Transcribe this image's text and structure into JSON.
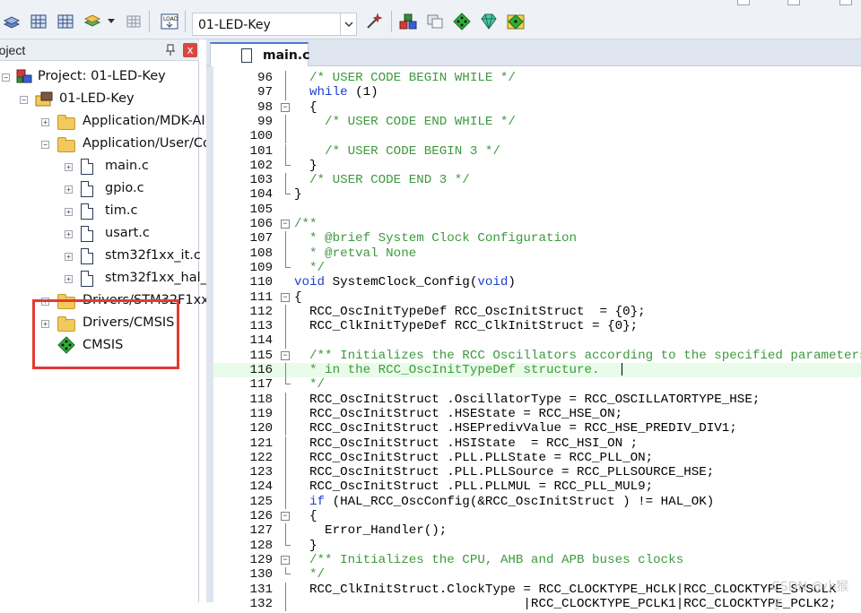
{
  "toolbar": {
    "target_name": "01-LED-Key",
    "colors": {
      "accent": "#4a7bd0",
      "highlight_box": "#e23b33"
    },
    "icons": [
      "stack-icon",
      "grid-icon",
      "grid-icon-2",
      "layers-icon",
      "settings-grid-icon",
      "load-icon",
      "magic-wand-icon",
      "manage-components-icon",
      "copy-icon",
      "debug-diamond-icon",
      "gem-icon",
      "pack-installer-icon"
    ]
  },
  "project_panel": {
    "title": "roject",
    "pin_glyph": "ᵖ",
    "close_glyph": "x",
    "tree": [
      {
        "label": "Project: 01-LED-Key",
        "level": 0,
        "type": "project",
        "expander": "−"
      },
      {
        "label": "01-LED-Key",
        "level": 1,
        "type": "target",
        "expander": "−"
      },
      {
        "label": "Application/MDK-AI",
        "level": 2,
        "type": "folder",
        "expander": "+"
      },
      {
        "label": "Application/User/Co",
        "level": 2,
        "type": "folder",
        "expander": "−"
      },
      {
        "label": "main.c",
        "level": 3,
        "type": "file",
        "expander": "+"
      },
      {
        "label": "gpio.c",
        "level": 3,
        "type": "file",
        "expander": "+"
      },
      {
        "label": "tim.c",
        "level": 3,
        "type": "file",
        "expander": "+"
      },
      {
        "label": "usart.c",
        "level": 3,
        "type": "file",
        "expander": "+"
      },
      {
        "label": "stm32f1xx_it.c",
        "level": 3,
        "type": "file",
        "expander": "+"
      },
      {
        "label": "stm32f1xx_hal_m",
        "level": 3,
        "type": "file",
        "expander": "+"
      },
      {
        "label": "Drivers/STM32F1xx_",
        "level": 2,
        "type": "folder",
        "expander": "+"
      },
      {
        "label": "Drivers/CMSIS",
        "level": 2,
        "type": "folder",
        "expander": "+"
      },
      {
        "label": "CMSIS",
        "level": 2,
        "type": "component",
        "expander": ""
      }
    ]
  },
  "editor": {
    "tab_label": "main.c",
    "lines": [
      {
        "num": "96",
        "text": "  /* USER CODE BEGIN WHILE */",
        "kind": "comment",
        "fold": "line"
      },
      {
        "num": "97",
        "text": "  while (1)",
        "kind": "keyword",
        "fold": "line"
      },
      {
        "num": "98",
        "text": "  {",
        "kind": "code",
        "fold": "box"
      },
      {
        "num": "99",
        "text": "    /* USER CODE END WHILE */",
        "kind": "comment",
        "fold": "line"
      },
      {
        "num": "100",
        "text": "",
        "kind": "code",
        "fold": "line"
      },
      {
        "num": "101",
        "text": "    /* USER CODE BEGIN 3 */",
        "kind": "comment",
        "fold": "line"
      },
      {
        "num": "102",
        "text": "  }",
        "kind": "code",
        "fold": "end"
      },
      {
        "num": "103",
        "text": "  /* USER CODE END 3 */",
        "kind": "comment",
        "fold": "line"
      },
      {
        "num": "104",
        "text": "}",
        "kind": "code",
        "fold": "end"
      },
      {
        "num": "105",
        "text": "",
        "kind": "code",
        "fold": ""
      },
      {
        "num": "106",
        "text": "/**",
        "kind": "comment",
        "fold": "box"
      },
      {
        "num": "107",
        "text": "  * @brief System Clock Configuration",
        "kind": "comment",
        "fold": "line"
      },
      {
        "num": "108",
        "text": "  * @retval None",
        "kind": "comment",
        "fold": "line"
      },
      {
        "num": "109",
        "text": "  */",
        "kind": "comment",
        "fold": "end"
      },
      {
        "num": "110",
        "text": "void SystemClock_Config(void)",
        "kind": "keyword",
        "fold": ""
      },
      {
        "num": "111",
        "text": "{",
        "kind": "code",
        "fold": "box"
      },
      {
        "num": "112",
        "text": "  RCC_OscInitTypeDef RCC_OscInitStruct  = {0};",
        "kind": "code",
        "fold": "line"
      },
      {
        "num": "113",
        "text": "  RCC_ClkInitTypeDef RCC_ClkInitStruct = {0};",
        "kind": "code",
        "fold": "line"
      },
      {
        "num": "114",
        "text": "",
        "kind": "code",
        "fold": "line"
      },
      {
        "num": "115",
        "text": "  /** Initializes the RCC Oscillators according to the specified parameters",
        "kind": "comment",
        "fold": "box"
      },
      {
        "num": "116",
        "text": "  * in the RCC_OscInitTypeDef structure.",
        "kind": "comment",
        "fold": "line",
        "current": true
      },
      {
        "num": "117",
        "text": "  */",
        "kind": "comment",
        "fold": "end"
      },
      {
        "num": "118",
        "text": "  RCC_OscInitStruct .OscillatorType = RCC_OSCILLATORTYPE_HSE;",
        "kind": "code",
        "fold": "line"
      },
      {
        "num": "119",
        "text": "  RCC_OscInitStruct .HSEState = RCC_HSE_ON;",
        "kind": "code",
        "fold": "line"
      },
      {
        "num": "120",
        "text": "  RCC_OscInitStruct .HSEPredivValue = RCC_HSE_PREDIV_DIV1;",
        "kind": "code",
        "fold": "line"
      },
      {
        "num": "121",
        "text": "  RCC_OscInitStruct .HSIState  = RCC_HSI_ON ;",
        "kind": "code",
        "fold": "line"
      },
      {
        "num": "122",
        "text": "  RCC_OscInitStruct .PLL.PLLState = RCC_PLL_ON;",
        "kind": "code",
        "fold": "line"
      },
      {
        "num": "123",
        "text": "  RCC_OscInitStruct .PLL.PLLSource = RCC_PLLSOURCE_HSE;",
        "kind": "code",
        "fold": "line"
      },
      {
        "num": "124",
        "text": "  RCC_OscInitStruct .PLL.PLLMUL = RCC_PLL_MUL9;",
        "kind": "code",
        "fold": "line"
      },
      {
        "num": "125",
        "text": "  if (HAL_RCC_OscConfig(&RCC_OscInitStruct ) != HAL_OK)",
        "kind": "keyword",
        "fold": "line"
      },
      {
        "num": "126",
        "text": "  {",
        "kind": "code",
        "fold": "box"
      },
      {
        "num": "127",
        "text": "    Error_Handler();",
        "kind": "code",
        "fold": "line"
      },
      {
        "num": "128",
        "text": "  }",
        "kind": "code",
        "fold": "end"
      },
      {
        "num": "129",
        "text": "  /** Initializes the CPU, AHB and APB buses clocks",
        "kind": "comment",
        "fold": "box"
      },
      {
        "num": "130",
        "text": "  */",
        "kind": "comment",
        "fold": "end"
      },
      {
        "num": "131",
        "text": "  RCC_ClkInitStruct.ClockType = RCC_CLOCKTYPE_HCLK|RCC_CLOCKTYPE_SYSCLK",
        "kind": "code",
        "fold": "line"
      },
      {
        "num": "132",
        "text": "                              |RCC_CLOCKTYPE_PCLK1|RCC_CLOCKTYPE_PCLK2;",
        "kind": "code",
        "fold": "line"
      }
    ],
    "watermark": "CSDN @小猴子"
  }
}
